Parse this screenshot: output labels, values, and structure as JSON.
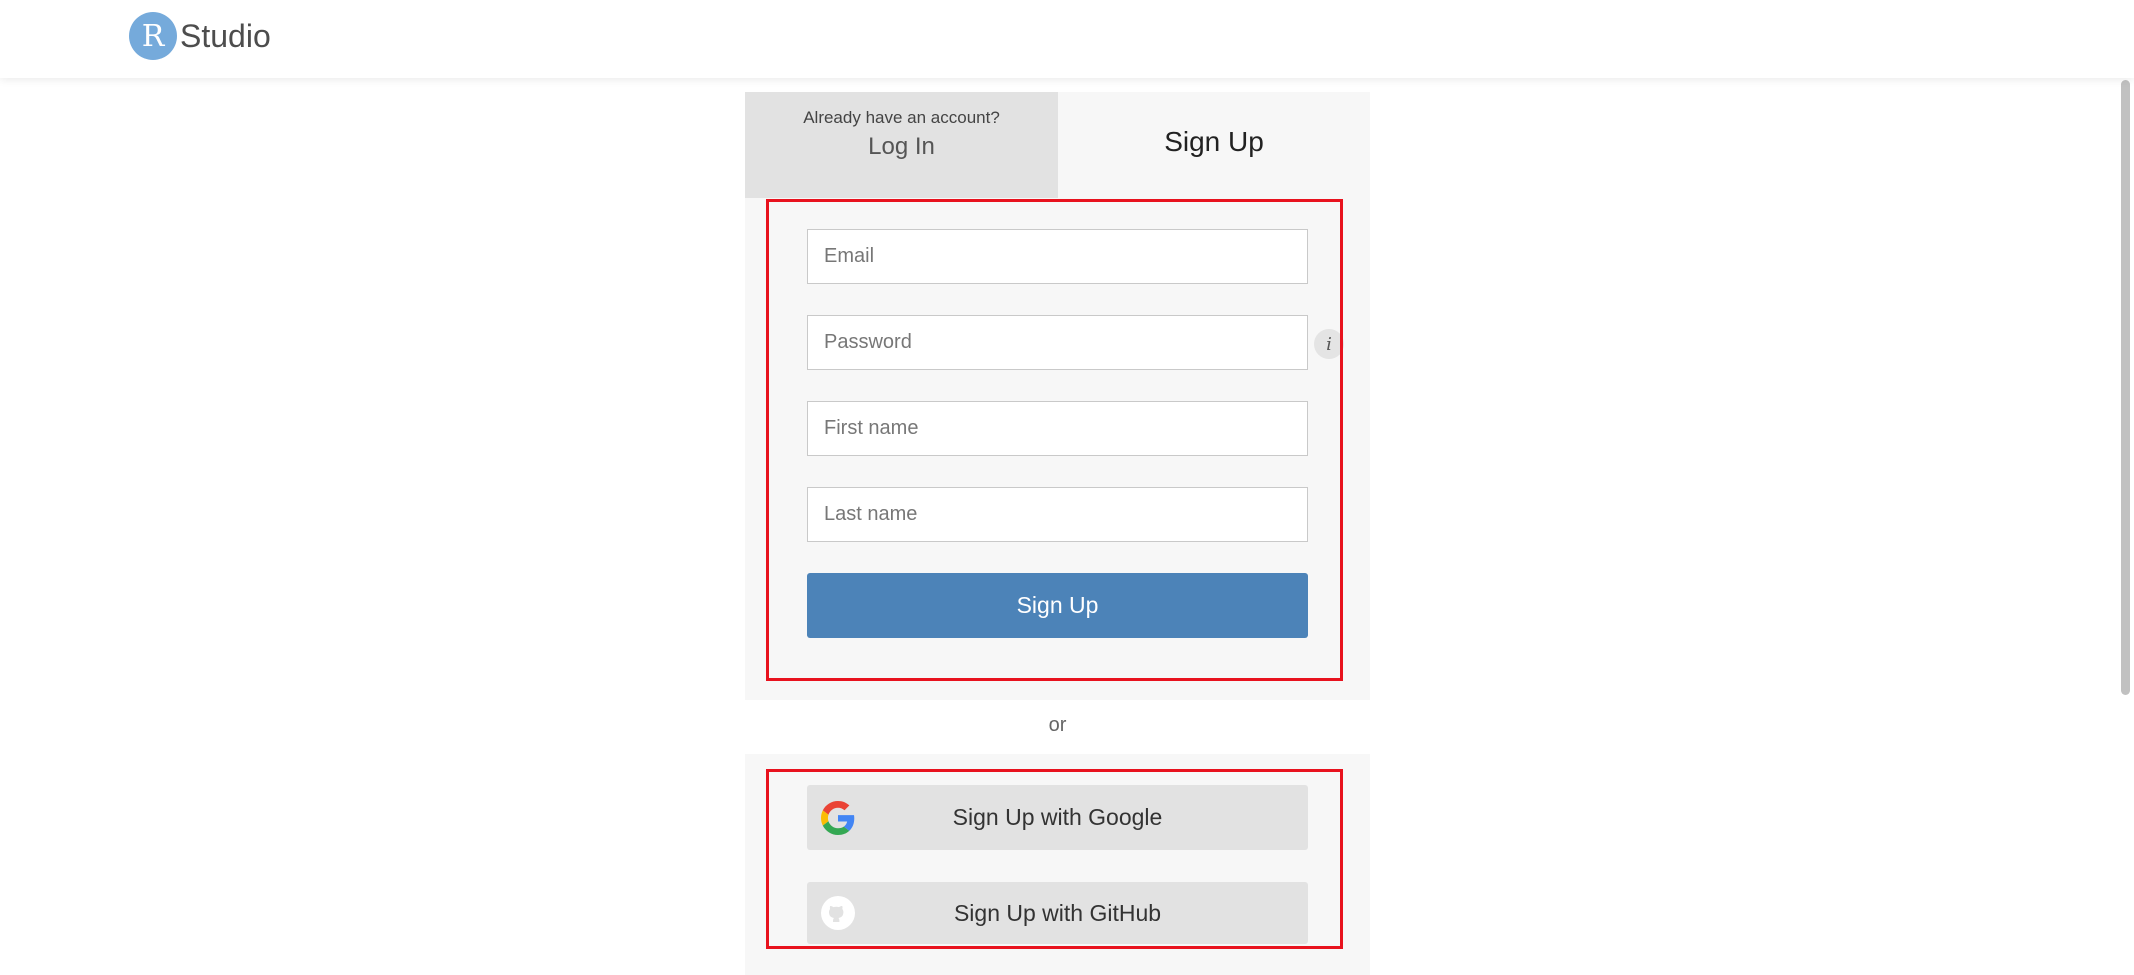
{
  "brand": {
    "logo_letter": "R",
    "logo_text": "Studio",
    "color": "#75AADB"
  },
  "tabs": {
    "login": {
      "subtitle": "Already have an account?",
      "label": "Log In"
    },
    "signup": {
      "label": "Sign Up"
    }
  },
  "form": {
    "email_placeholder": "Email",
    "password_placeholder": "Password",
    "password_info_icon": "i",
    "first_name_placeholder": "First name",
    "last_name_placeholder": "Last name",
    "submit_label": "Sign Up"
  },
  "separator": "or",
  "social": {
    "google_label": "Sign Up with Google",
    "github_label": "Sign Up with GitHub"
  },
  "colors": {
    "primary_button": "#4C83B8",
    "highlight": "#e8121e",
    "panel": "#f7f7f7",
    "inactive_tab": "#e2e2e2"
  }
}
